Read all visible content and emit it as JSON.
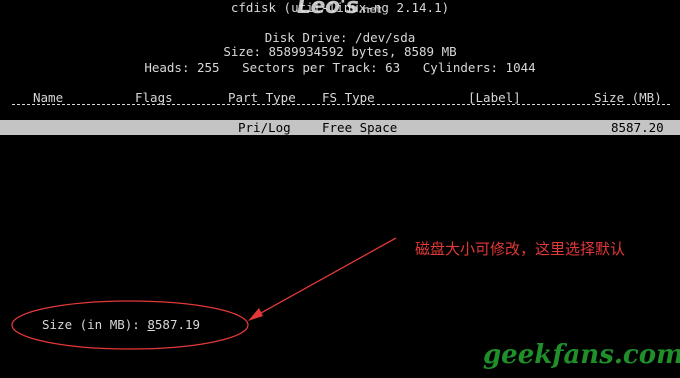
{
  "title_line": "cfdisk (util-linux-ng 2.14.1)",
  "watermark": {
    "main": "Leo's",
    "suffix": ".net"
  },
  "disk_drive_line": "Disk Drive: /dev/sda",
  "size_line": "Size: 8589934592 bytes, 8589 MB",
  "geometry_line": "Heads: 255   Sectors per Track: 63   Cylinders: 1044",
  "columns": {
    "name": "Name",
    "flags": "Flags",
    "part_type": "Part Type",
    "fs_type": "FS Type",
    "label": "[Label]",
    "size": "Size (MB)"
  },
  "selected_row": {
    "part_type": "Pri/Log",
    "fs_type": "Free Space",
    "size": "8587.20"
  },
  "prompt": {
    "label": "Size (in MB): ",
    "cursor_char": "8",
    "rest": "587.19"
  },
  "annotation": "磁盘大小可修改，这里选择默认",
  "footer_watermark": "geekfans.com",
  "colors": {
    "background": "#000000",
    "terminal_text": "#d8d8d8",
    "highlight_row": "#c4c4c4",
    "annotation_red": "#e23838",
    "footer_green": "#1f8f2a"
  }
}
